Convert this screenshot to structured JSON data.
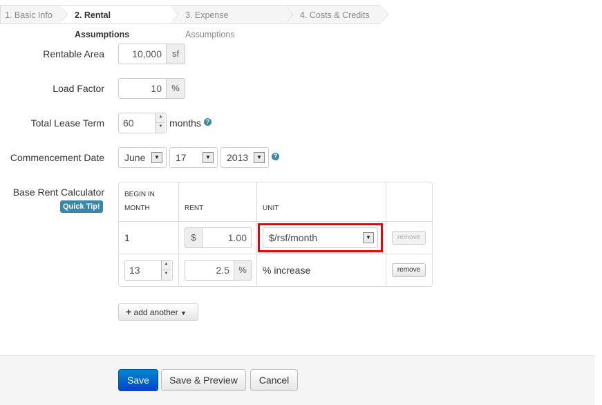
{
  "wizard": {
    "steps": [
      {
        "label": "1. Basic Info"
      },
      {
        "label": "2. Rental Assumptions"
      },
      {
        "label": "3. Expense Assumptions"
      },
      {
        "label": "4. Costs & Credits"
      }
    ],
    "active_step": 2
  },
  "form": {
    "rentable_area": {
      "label": "Rentable Area",
      "value": "10,000",
      "unit": "sf"
    },
    "load_factor": {
      "label": "Load Factor",
      "value": "10",
      "unit": "%"
    },
    "lease_term": {
      "label": "Total Lease Term",
      "value": "60",
      "unit": "months",
      "help": "?"
    },
    "commencement": {
      "label": "Commencement Date",
      "month": "June",
      "day": "17",
      "year": "2013",
      "help": "?"
    }
  },
  "rent_calc": {
    "label": "Base Rent Calculator",
    "tip": "Quick Tip!",
    "headers": {
      "begin_line1": "BEGIN IN",
      "begin_line2": "MONTH",
      "rent": "RENT",
      "unit": "UNIT"
    },
    "rows": [
      {
        "begin": "1",
        "prefix": "$",
        "rent": "1.00",
        "unit": "$/rsf/month",
        "remove": "remove",
        "remove_disabled": true
      },
      {
        "begin": "13",
        "rent": "2.5",
        "suffix": "%",
        "unit": "% increase",
        "remove": "remove",
        "remove_disabled": false
      }
    ],
    "add_label": "add another",
    "add_icon": "plus-icon"
  },
  "footer": {
    "save": "Save",
    "save_preview": "Save & Preview",
    "cancel": "Cancel"
  },
  "colors": {
    "primary": "#0055cc",
    "tip": "#3a87ad",
    "highlight": "#ee0000"
  }
}
